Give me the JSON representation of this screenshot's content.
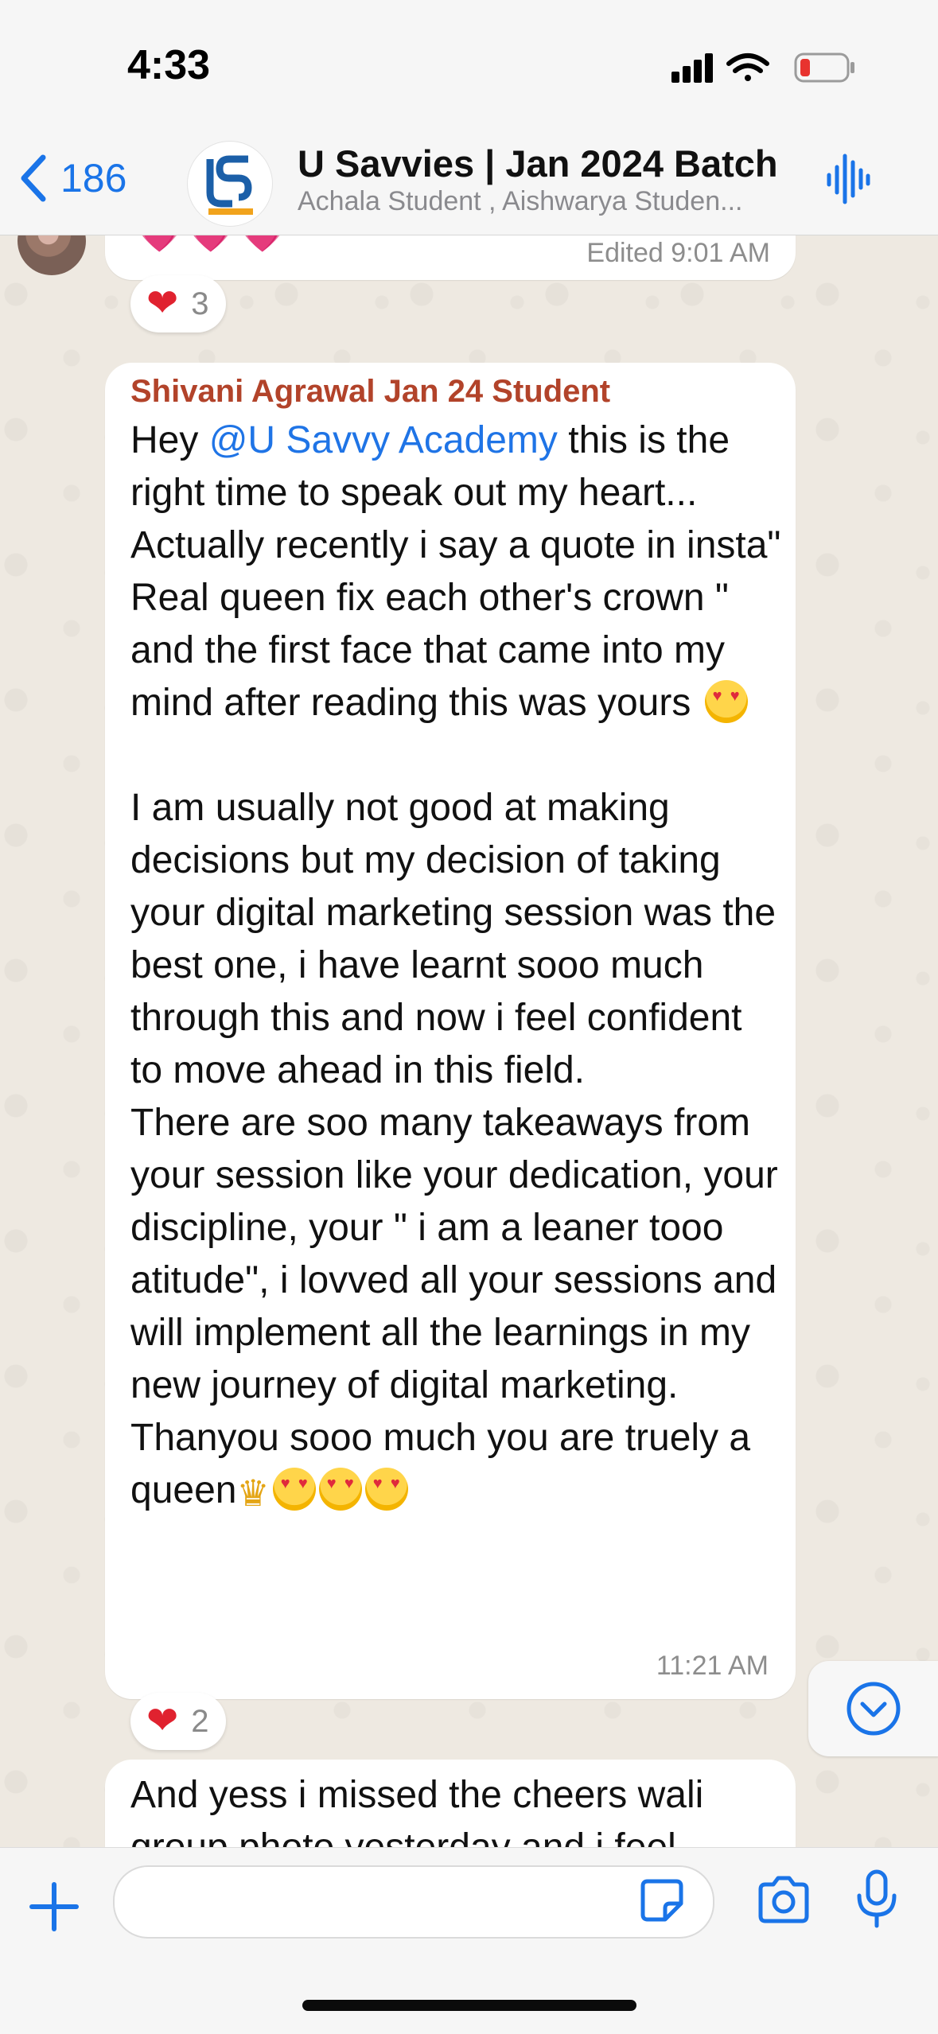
{
  "status_bar": {
    "time": "4:33"
  },
  "header": {
    "back_count": "186",
    "title": "U Savvies | Jan 2024 Batch",
    "subtitle": "Achala Student , Aishwarya Studen..."
  },
  "messages": {
    "prev": {
      "emojis": "💗💗💗",
      "edited_label": "Edited 9:01 AM",
      "reaction_count": "3"
    },
    "main": {
      "sender": "Shivani Agrawal Jan 24 Student",
      "lead_text": "Hey ",
      "mention": "@U Savvy Academy",
      "text_before_emoji": " this is the right time to speak out my heart... Actually recently i say a quote in insta\" Real queen fix each other's crown \" and the first face that came into my mind after reading this was yours ",
      "paragraph2": "\n\nI am usually not good at making decisions but my decision of taking your digital marketing session was the best one, i have learnt sooo much through this and now i feel confident to move ahead in this field.\nThere are soo many takeaways from your session like your dedication, your discipline, your \" i am a leaner tooo atitude\", i lovved all your sessions and will implement all the learnings in my new journey of digital marketing.\nThanyou sooo much you are truely a queen",
      "time": "11:21 AM",
      "reaction_count": "2"
    },
    "next": {
      "text": "And yess i missed the cheers wali group photo yesterday and i feel"
    }
  },
  "colors": {
    "accent": "#1a74e8",
    "sender_name": "#b2432a",
    "reaction_heart": "#e0222f"
  },
  "icons": [
    "back-chevron-icon",
    "signal-icon",
    "wifi-icon",
    "battery-icon",
    "voice-wave-icon",
    "scroll-down-icon",
    "plus-icon",
    "sticker-icon",
    "camera-icon",
    "mic-icon"
  ]
}
